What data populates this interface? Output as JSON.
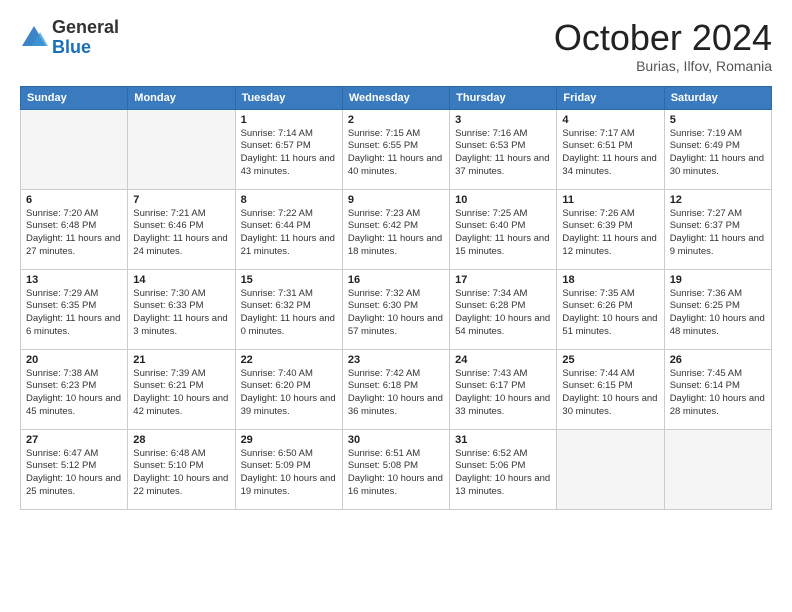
{
  "logo": {
    "general": "General",
    "blue": "Blue"
  },
  "header": {
    "month": "October 2024",
    "location": "Burias, Ilfov, Romania"
  },
  "weekdays": [
    "Sunday",
    "Monday",
    "Tuesday",
    "Wednesday",
    "Thursday",
    "Friday",
    "Saturday"
  ],
  "weeks": [
    [
      {
        "day": "",
        "empty": true
      },
      {
        "day": "",
        "empty": true
      },
      {
        "day": "1",
        "sunrise": "Sunrise: 7:14 AM",
        "sunset": "Sunset: 6:57 PM",
        "daylight": "Daylight: 11 hours and 43 minutes."
      },
      {
        "day": "2",
        "sunrise": "Sunrise: 7:15 AM",
        "sunset": "Sunset: 6:55 PM",
        "daylight": "Daylight: 11 hours and 40 minutes."
      },
      {
        "day": "3",
        "sunrise": "Sunrise: 7:16 AM",
        "sunset": "Sunset: 6:53 PM",
        "daylight": "Daylight: 11 hours and 37 minutes."
      },
      {
        "day": "4",
        "sunrise": "Sunrise: 7:17 AM",
        "sunset": "Sunset: 6:51 PM",
        "daylight": "Daylight: 11 hours and 34 minutes."
      },
      {
        "day": "5",
        "sunrise": "Sunrise: 7:19 AM",
        "sunset": "Sunset: 6:49 PM",
        "daylight": "Daylight: 11 hours and 30 minutes."
      }
    ],
    [
      {
        "day": "6",
        "sunrise": "Sunrise: 7:20 AM",
        "sunset": "Sunset: 6:48 PM",
        "daylight": "Daylight: 11 hours and 27 minutes."
      },
      {
        "day": "7",
        "sunrise": "Sunrise: 7:21 AM",
        "sunset": "Sunset: 6:46 PM",
        "daylight": "Daylight: 11 hours and 24 minutes."
      },
      {
        "day": "8",
        "sunrise": "Sunrise: 7:22 AM",
        "sunset": "Sunset: 6:44 PM",
        "daylight": "Daylight: 11 hours and 21 minutes."
      },
      {
        "day": "9",
        "sunrise": "Sunrise: 7:23 AM",
        "sunset": "Sunset: 6:42 PM",
        "daylight": "Daylight: 11 hours and 18 minutes."
      },
      {
        "day": "10",
        "sunrise": "Sunrise: 7:25 AM",
        "sunset": "Sunset: 6:40 PM",
        "daylight": "Daylight: 11 hours and 15 minutes."
      },
      {
        "day": "11",
        "sunrise": "Sunrise: 7:26 AM",
        "sunset": "Sunset: 6:39 PM",
        "daylight": "Daylight: 11 hours and 12 minutes."
      },
      {
        "day": "12",
        "sunrise": "Sunrise: 7:27 AM",
        "sunset": "Sunset: 6:37 PM",
        "daylight": "Daylight: 11 hours and 9 minutes."
      }
    ],
    [
      {
        "day": "13",
        "sunrise": "Sunrise: 7:29 AM",
        "sunset": "Sunset: 6:35 PM",
        "daylight": "Daylight: 11 hours and 6 minutes."
      },
      {
        "day": "14",
        "sunrise": "Sunrise: 7:30 AM",
        "sunset": "Sunset: 6:33 PM",
        "daylight": "Daylight: 11 hours and 3 minutes."
      },
      {
        "day": "15",
        "sunrise": "Sunrise: 7:31 AM",
        "sunset": "Sunset: 6:32 PM",
        "daylight": "Daylight: 11 hours and 0 minutes."
      },
      {
        "day": "16",
        "sunrise": "Sunrise: 7:32 AM",
        "sunset": "Sunset: 6:30 PM",
        "daylight": "Daylight: 10 hours and 57 minutes."
      },
      {
        "day": "17",
        "sunrise": "Sunrise: 7:34 AM",
        "sunset": "Sunset: 6:28 PM",
        "daylight": "Daylight: 10 hours and 54 minutes."
      },
      {
        "day": "18",
        "sunrise": "Sunrise: 7:35 AM",
        "sunset": "Sunset: 6:26 PM",
        "daylight": "Daylight: 10 hours and 51 minutes."
      },
      {
        "day": "19",
        "sunrise": "Sunrise: 7:36 AM",
        "sunset": "Sunset: 6:25 PM",
        "daylight": "Daylight: 10 hours and 48 minutes."
      }
    ],
    [
      {
        "day": "20",
        "sunrise": "Sunrise: 7:38 AM",
        "sunset": "Sunset: 6:23 PM",
        "daylight": "Daylight: 10 hours and 45 minutes."
      },
      {
        "day": "21",
        "sunrise": "Sunrise: 7:39 AM",
        "sunset": "Sunset: 6:21 PM",
        "daylight": "Daylight: 10 hours and 42 minutes."
      },
      {
        "day": "22",
        "sunrise": "Sunrise: 7:40 AM",
        "sunset": "Sunset: 6:20 PM",
        "daylight": "Daylight: 10 hours and 39 minutes."
      },
      {
        "day": "23",
        "sunrise": "Sunrise: 7:42 AM",
        "sunset": "Sunset: 6:18 PM",
        "daylight": "Daylight: 10 hours and 36 minutes."
      },
      {
        "day": "24",
        "sunrise": "Sunrise: 7:43 AM",
        "sunset": "Sunset: 6:17 PM",
        "daylight": "Daylight: 10 hours and 33 minutes."
      },
      {
        "day": "25",
        "sunrise": "Sunrise: 7:44 AM",
        "sunset": "Sunset: 6:15 PM",
        "daylight": "Daylight: 10 hours and 30 minutes."
      },
      {
        "day": "26",
        "sunrise": "Sunrise: 7:45 AM",
        "sunset": "Sunset: 6:14 PM",
        "daylight": "Daylight: 10 hours and 28 minutes."
      }
    ],
    [
      {
        "day": "27",
        "sunrise": "Sunrise: 6:47 AM",
        "sunset": "Sunset: 5:12 PM",
        "daylight": "Daylight: 10 hours and 25 minutes."
      },
      {
        "day": "28",
        "sunrise": "Sunrise: 6:48 AM",
        "sunset": "Sunset: 5:10 PM",
        "daylight": "Daylight: 10 hours and 22 minutes."
      },
      {
        "day": "29",
        "sunrise": "Sunrise: 6:50 AM",
        "sunset": "Sunset: 5:09 PM",
        "daylight": "Daylight: 10 hours and 19 minutes."
      },
      {
        "day": "30",
        "sunrise": "Sunrise: 6:51 AM",
        "sunset": "Sunset: 5:08 PM",
        "daylight": "Daylight: 10 hours and 16 minutes."
      },
      {
        "day": "31",
        "sunrise": "Sunrise: 6:52 AM",
        "sunset": "Sunset: 5:06 PM",
        "daylight": "Daylight: 10 hours and 13 minutes."
      },
      {
        "day": "",
        "empty": true
      },
      {
        "day": "",
        "empty": true
      }
    ]
  ]
}
